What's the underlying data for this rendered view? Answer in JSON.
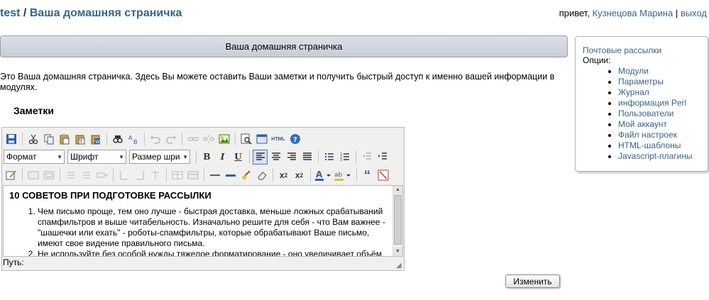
{
  "breadcrumb": {
    "root": "test",
    "separator": "/",
    "current": "Ваша домашняя страничка"
  },
  "userbar": {
    "greeting": "привет,",
    "user": "Кузнецова Марина",
    "separator": "|",
    "logout": "выход"
  },
  "header": {
    "title": "Ваша домашняя страничка"
  },
  "intro": "Это Ваша домашняя страничка. Здесь Вы можете оставить Ваши заметки и получить быстрый доступ к именно вашей информации в модулях.",
  "notes_title": "Заметки",
  "editor": {
    "format_select": "Формат",
    "font_select": "Шрифт",
    "size_select": "Размер шри",
    "html_button": "HTML",
    "content": {
      "heading": "10 СОВЕТОВ ПРИ ПОДГОТОВКЕ РАССЫЛКИ",
      "items": [
        "Чем письмо проще, тем оно лучше - быстрая доставка, меньше ложных срабатываний спамфильтров и выше читабельность. Изначально решите для себя - что Вам важнее - \"шашечки или ехать\" - роботы-спамфильтры, которые обрабатывают Ваше письмо, имеют свое видение правильного письма.",
        "Не используйте без особой нужды тяжелое форматирование - оно увеличивает объём"
      ]
    },
    "path_label": "Путь:"
  },
  "submit_label": "Изменить",
  "sidebar": {
    "title": "Почтовые рассылки",
    "options_label": "Опции:",
    "items": [
      "Модули",
      "Параметры",
      "Журнал",
      "информация Perl",
      "Пользователи",
      "Мой аккаунт",
      "Файл настроек",
      "HTML-шаблоны",
      "Javascript-плагины"
    ]
  }
}
